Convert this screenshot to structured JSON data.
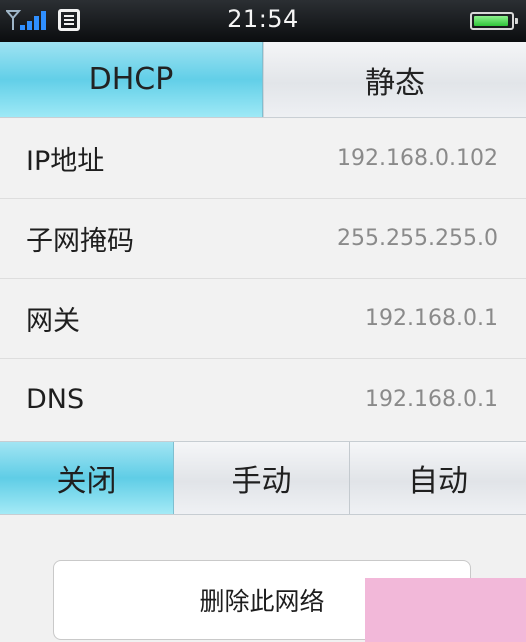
{
  "status_bar": {
    "time": "21:54",
    "signal_icon": "signal-strength-icon",
    "sim_icon": "sim-card-icon",
    "battery_icon": "battery-icon"
  },
  "ip_mode": {
    "tabs": [
      {
        "label": "DHCP",
        "selected": true
      },
      {
        "label": "静态",
        "selected": false
      }
    ]
  },
  "network_info": {
    "rows": [
      {
        "label": "IP地址",
        "value": "192.168.0.102"
      },
      {
        "label": "子网掩码",
        "value": "255.255.255.0"
      },
      {
        "label": "网关",
        "value": "192.168.0.1"
      },
      {
        "label": "DNS",
        "value": "192.168.0.1"
      }
    ]
  },
  "proxy": {
    "options": [
      {
        "label": "关闭",
        "selected": true
      },
      {
        "label": "手动",
        "selected": false
      },
      {
        "label": "自动",
        "selected": false
      }
    ]
  },
  "actions": {
    "delete_label": "删除此网络"
  },
  "colors": {
    "accent_active": "#62cfe8",
    "status_bar_bg": "#0b0d0f",
    "battery_green": "#2fc43a"
  }
}
